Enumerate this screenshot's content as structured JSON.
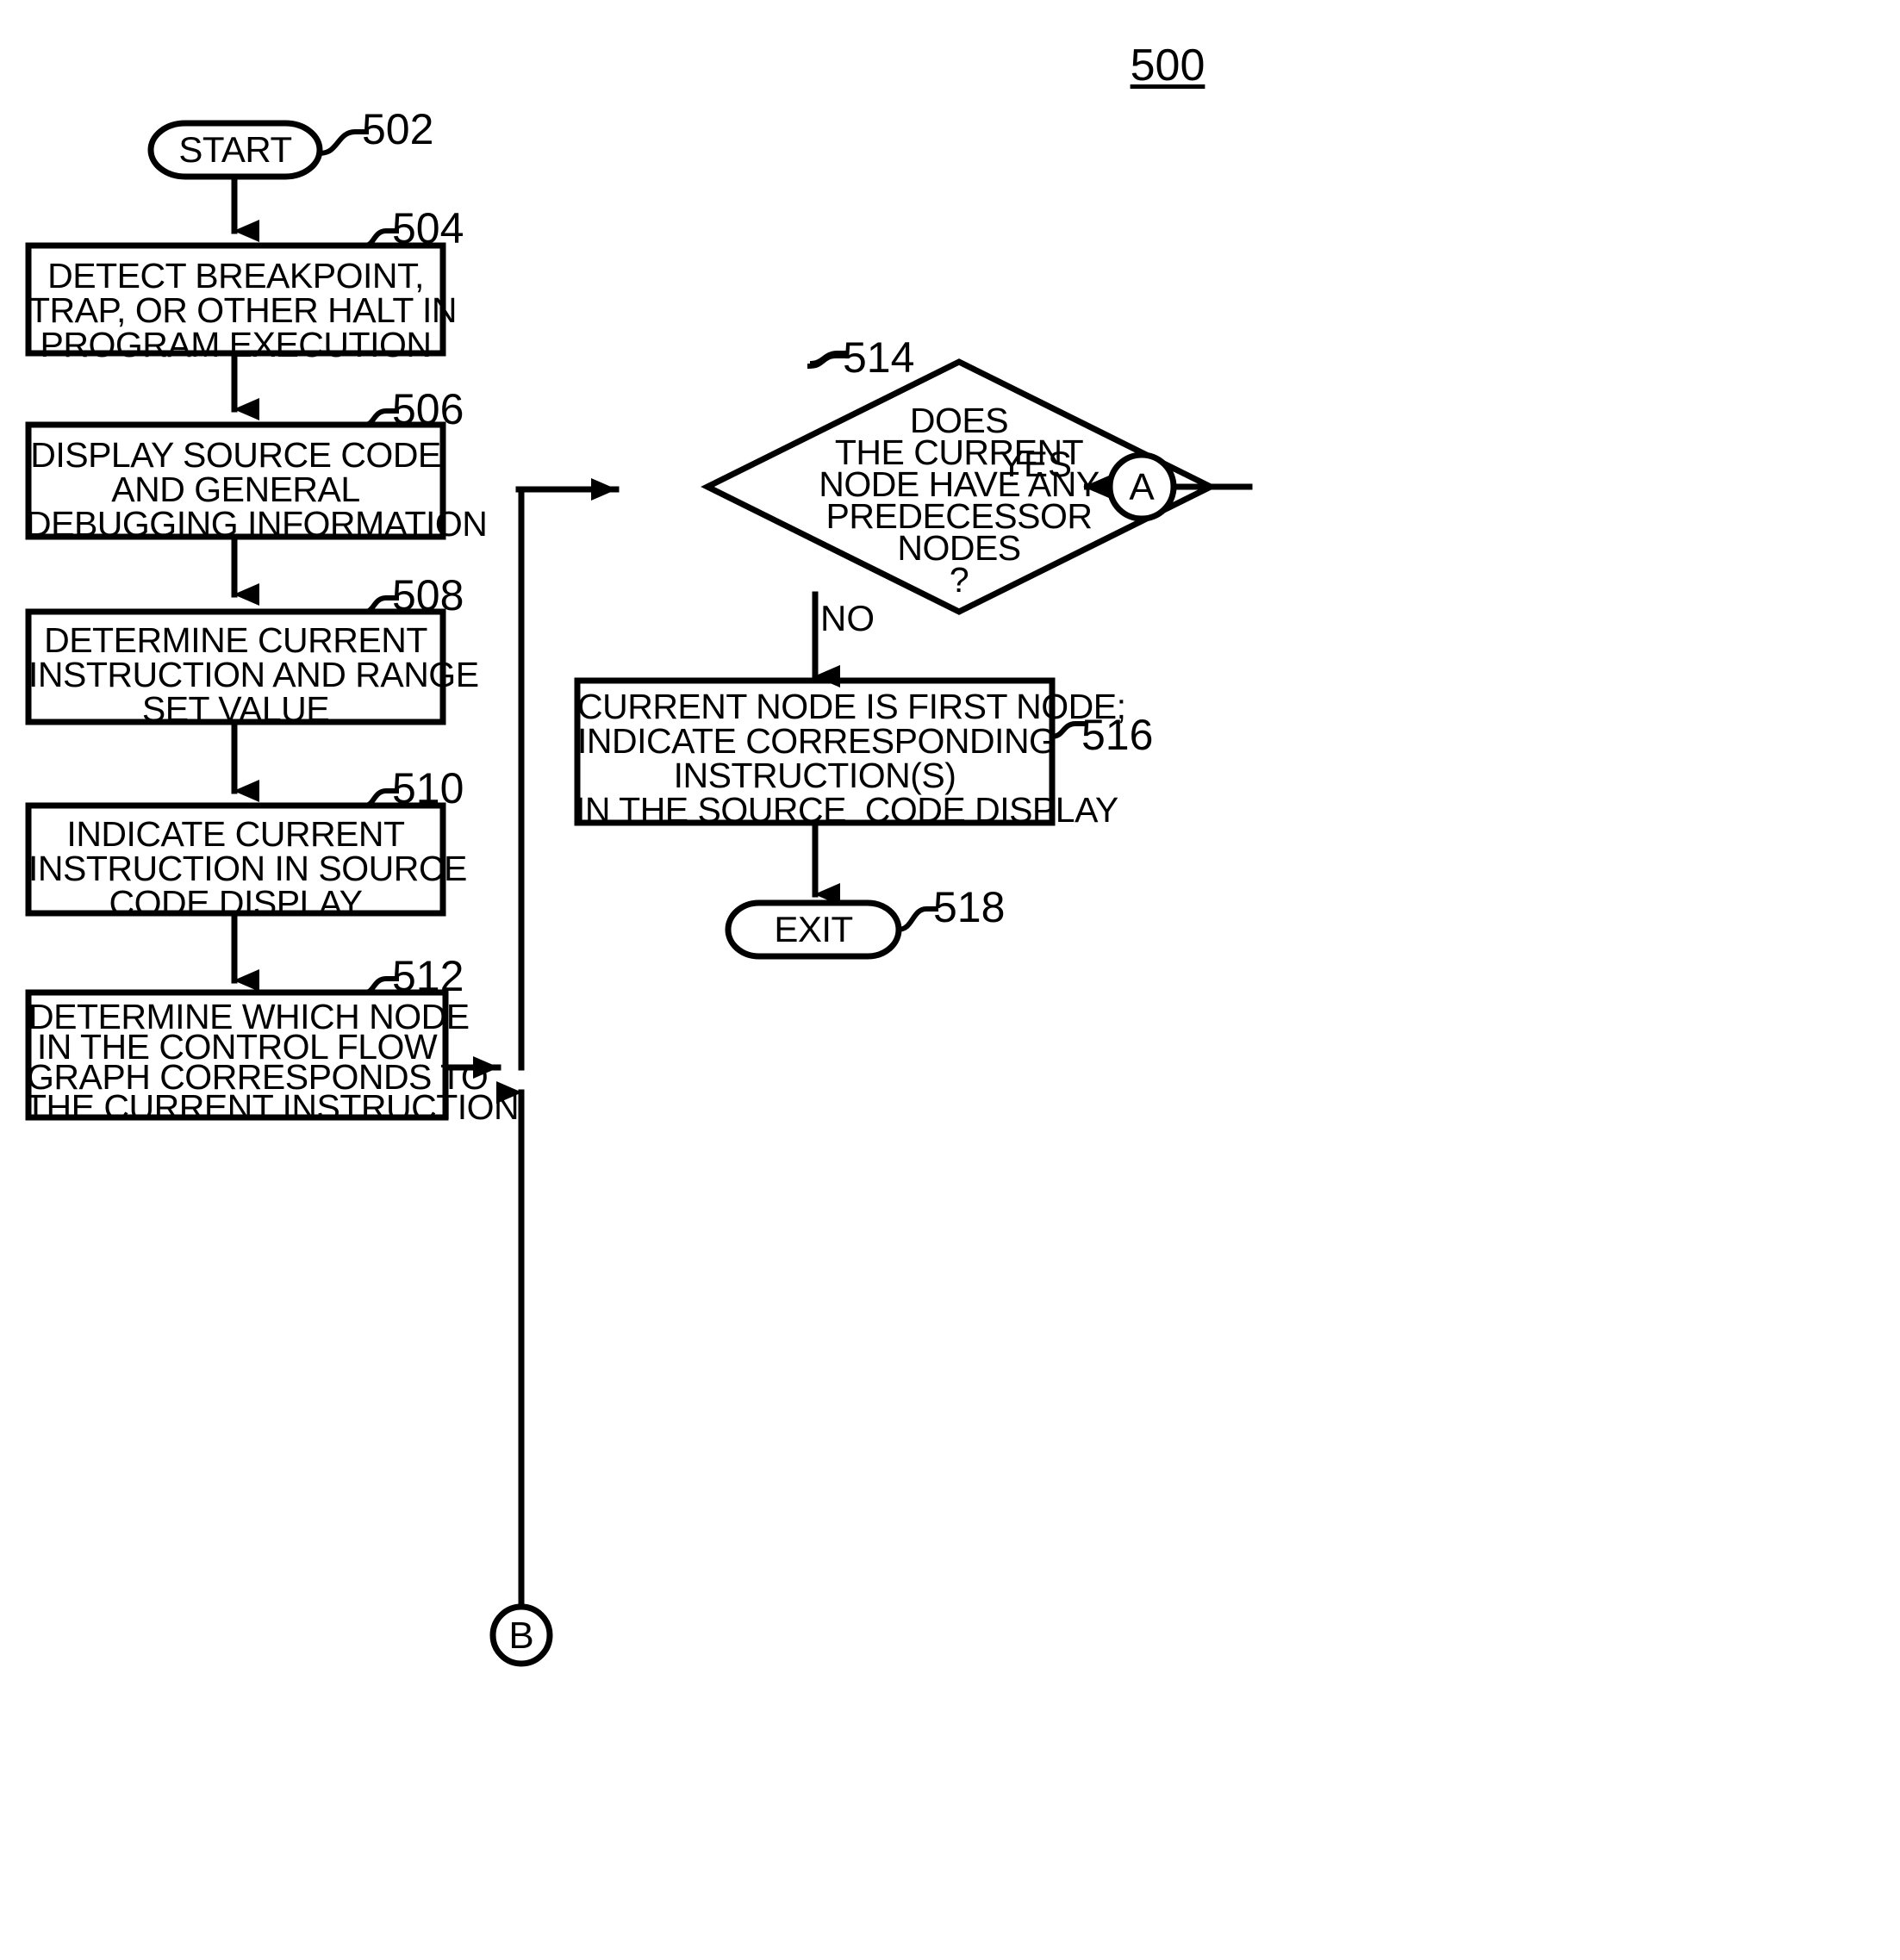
{
  "figure": {
    "title": "500"
  },
  "terminators": {
    "start": {
      "label": "START",
      "ref": "502"
    },
    "exit": {
      "label": "EXIT",
      "ref": "518"
    }
  },
  "connectors": {
    "a": {
      "label": "A"
    },
    "b": {
      "label": "B"
    }
  },
  "steps": [
    {
      "ref": "504",
      "lines": [
        "DETECT BREAKPOINT,",
        "TRAP, OR OTHER HALT IN",
        "PROGRAM EXECUTION"
      ]
    },
    {
      "ref": "506",
      "lines": [
        "DISPLAY SOURCE CODE",
        "AND GENERAL",
        "DEBUGGING INFORMATION"
      ]
    },
    {
      "ref": "508",
      "lines": [
        "DETERMINE CURRENT",
        "INSTRUCTION AND RANGE",
        "SET VALUE"
      ]
    },
    {
      "ref": "510",
      "lines": [
        "INDICATE CURRENT",
        "INSTRUCTION IN SOURCE",
        "CODE DISPLAY"
      ]
    },
    {
      "ref": "512",
      "lines": [
        "DETERMINE WHICH NODE",
        "IN THE CONTROL FLOW",
        "GRAPH CORRESPONDS TO",
        "THE CURRENT INSTRUCTION"
      ]
    },
    {
      "ref": "516",
      "lines": [
        "CURRENT NODE IS FIRST NODE;",
        "INDICATE CORRESPONDING",
        "INSTRUCTION(S)",
        "IN THE SOURCE  CODE DISPLAY"
      ]
    }
  ],
  "decision": {
    "ref": "514",
    "lines": [
      "DOES",
      "THE CURRENT",
      "NODE HAVE ANY",
      "PREDECESSOR",
      "NODES",
      "?"
    ],
    "yes_label": "YES",
    "no_label": "NO"
  },
  "colors": {
    "stroke": "#000000",
    "background": "#ffffff"
  }
}
